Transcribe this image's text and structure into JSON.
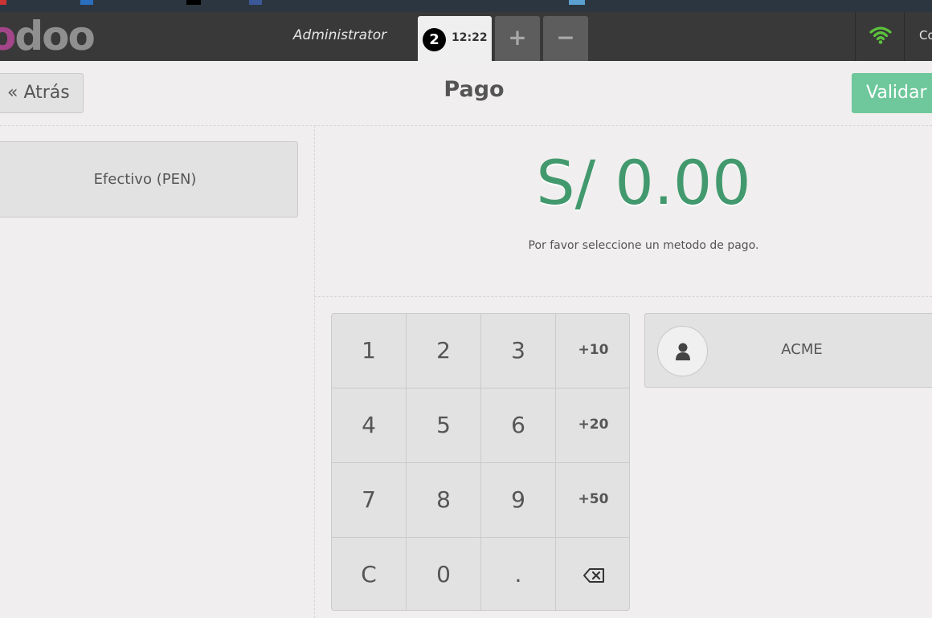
{
  "header": {
    "logo": "odoo",
    "username": "Administrator",
    "order": {
      "number": "2",
      "time": "12:22"
    },
    "add_order_icon": "+",
    "remove_order_icon": "−",
    "more_label": "Co"
  },
  "toolbar": {
    "back_label": "« Atrás",
    "title": "Pago",
    "validate_label": "Validar"
  },
  "payment_methods": [
    {
      "label": "Efectivo (PEN)"
    }
  ],
  "total": {
    "amount": "S/ 0.00",
    "message": "Por favor seleccione un metodo de pago."
  },
  "numpad": {
    "keys": [
      "1",
      "2",
      "3",
      "+10",
      "4",
      "5",
      "6",
      "+20",
      "7",
      "8",
      "9",
      "+50",
      "C",
      "0",
      ".",
      "backspace-icon"
    ]
  },
  "customer": {
    "name": "ACME",
    "icon": "user-icon"
  },
  "colors": {
    "accent_green": "#43996e",
    "validate_bg": "#6ec89b",
    "header_bg": "#393939",
    "wifi": "#5cc33c"
  }
}
